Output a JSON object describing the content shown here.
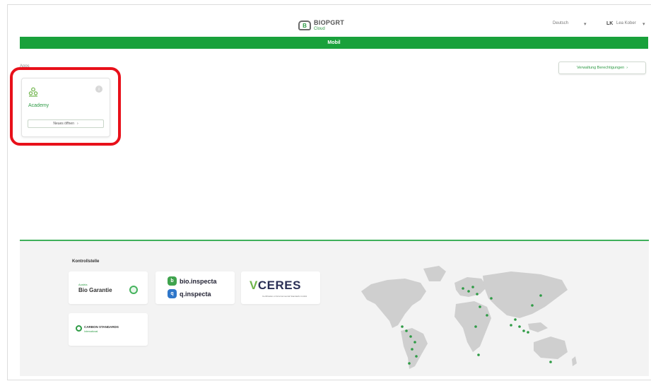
{
  "header": {
    "logo_name": "BIOPGRT",
    "logo_sub": "Cloud",
    "language": "Deutsch",
    "language_caret": "▾",
    "user_initials": "LK",
    "user_name": "Lea Kober",
    "user_caret": "▾"
  },
  "green_bar": {
    "title": "Mobil"
  },
  "services": {
    "section_label": "Apps",
    "manage_button": "Verwaltung Berechtigungen",
    "manage_button_icon": "›",
    "card": {
      "title": "Academy",
      "info_icon": "i",
      "action_label": "Neues öffnen",
      "action_icon": "›"
    }
  },
  "footer": {
    "title": "Kontrollstelle",
    "logos": {
      "bio_small": "Austria",
      "bio_big": "Bio Garantie",
      "inspecta_1": "bio.inspecta",
      "inspecta_2": "q.inspecta",
      "ceres_v": "V",
      "ceres_rest": "CERES",
      "ceres_sub": "Certification of Environmental Standards GmbH",
      "carbon": "CARBON STANDARDS",
      "carbon_sub": "International"
    }
  },
  "colors": {
    "brand_green": "#19a13b",
    "highlight_red": "#e8101a",
    "map_land": "#cfcfcf",
    "map_dot": "#2e9b45"
  },
  "icons": {
    "logo": "biopgrt-logo-icon",
    "academy": "academy-people-icon",
    "info": "info-icon",
    "world_map": "world-map-icon"
  }
}
